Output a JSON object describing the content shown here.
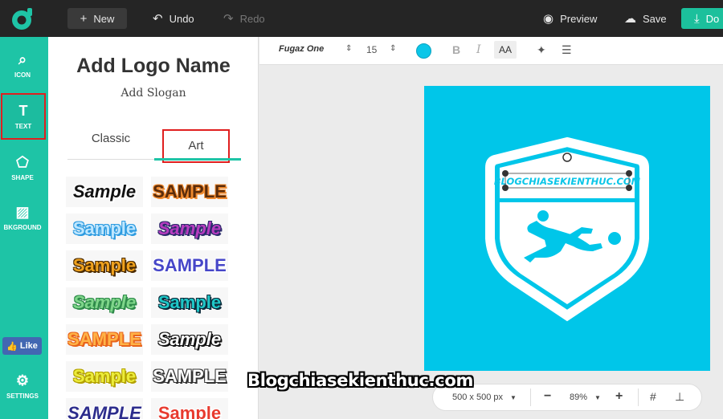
{
  "topbar": {
    "new_label": "New",
    "undo_label": "Undo",
    "redo_label": "Redo",
    "preview_label": "Preview",
    "save_label": "Save",
    "download_label": "Do"
  },
  "rail": {
    "icon_label": "ICON",
    "text_label": "TEXT",
    "shape_label": "SHAPE",
    "bkground_label": "BKGROUND",
    "like_label": "Like",
    "settings_label": "SETTINGS"
  },
  "panel": {
    "title": "Add Logo Name",
    "slogan": "Add Slogan",
    "tabs": [
      "Classic",
      "Art"
    ],
    "samples": [
      {
        "text": "Sample",
        "color": "#111111",
        "stroke": "#ffffff"
      },
      {
        "text": "SAMPLE",
        "color": "#5a2c0c",
        "stroke": "#f08a2e"
      },
      {
        "text": "Sample",
        "color": "#bfe7ff",
        "stroke": "#2d9be0"
      },
      {
        "text": "Sample",
        "color": "#b63cbf",
        "stroke": "#2a2a6a"
      },
      {
        "text": "Sample",
        "color": "#f0a21e",
        "stroke": "#4a2a00"
      },
      {
        "text": "SAMPLE",
        "color": "#4646c8",
        "stroke": "#ffffff"
      },
      {
        "text": "Sample",
        "color": "#7fd68a",
        "stroke": "#2e8b4a"
      },
      {
        "text": "Sample",
        "color": "#1fc7c7",
        "stroke": "#0b2a3a"
      },
      {
        "text": "SAMPLE",
        "color": "#ffb347",
        "stroke": "#e8641c"
      },
      {
        "text": "Sample",
        "color": "#ffffff",
        "stroke": "#111111"
      },
      {
        "text": "Sample",
        "color": "#ecec3a",
        "stroke": "#b3a100"
      },
      {
        "text": "SAMPLE",
        "color": "#ffffff",
        "stroke": "#333333"
      },
      {
        "text": "SAMPLE",
        "color": "#2c2c8c",
        "stroke": "#ffffff"
      },
      {
        "text": "Sample",
        "color": "#e83a2e",
        "stroke": "#ffffff"
      }
    ]
  },
  "toolbar": {
    "font_name": "Fugaz One",
    "font_size": "15",
    "text_color": "#0bc6e8",
    "bold_label": "B",
    "italic_label": "I",
    "case_label": "AA"
  },
  "canvas": {
    "background": "#00c6e9",
    "logo_text": "BLOGCHIASEKIENTHUC.COM"
  },
  "bottombar": {
    "dimensions": "500 x 500 px",
    "zoom": "89%"
  },
  "watermark": "Blogchiasekienthuc.com"
}
